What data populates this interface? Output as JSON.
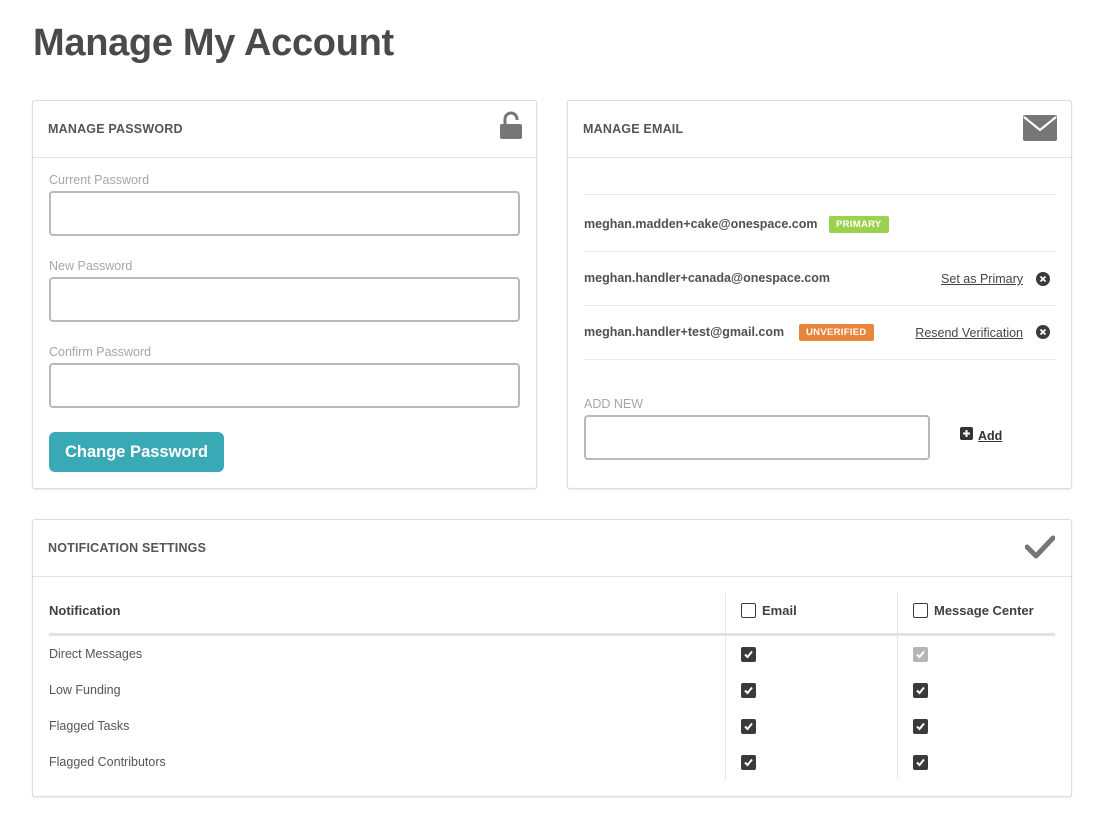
{
  "page": {
    "title": "Manage My Account"
  },
  "password_panel": {
    "title": "MANAGE PASSWORD",
    "icon": "unlock-icon",
    "fields": [
      {
        "label": "Current Password",
        "value": ""
      },
      {
        "label": "New Password",
        "value": ""
      },
      {
        "label": "Confirm Password",
        "value": ""
      }
    ],
    "submit_label": "Change Password"
  },
  "email_panel": {
    "title": "MANAGE EMAIL",
    "icon": "envelope-icon",
    "emails": [
      {
        "address": "meghan.madden+cake@onespace.com",
        "badge": "PRIMARY",
        "action": ""
      },
      {
        "address": "meghan.handler+canada@onespace.com",
        "badge": "",
        "action": "Set as Primary"
      },
      {
        "address": "meghan.handler+test@gmail.com",
        "badge": "UNVERIFIED",
        "action": "Resend Verification"
      }
    ],
    "add_new": {
      "label": "ADD NEW",
      "value": "",
      "button_label": "Add"
    }
  },
  "notification_panel": {
    "title": "NOTIFICATION SETTINGS",
    "icon": "checkmark-icon",
    "columns": {
      "notification": "Notification",
      "email": "Email",
      "message_center": "Message Center"
    },
    "header_checks": {
      "email": false,
      "message_center": false
    },
    "rows": [
      {
        "label": "Direct Messages",
        "email": true,
        "message_center": true,
        "message_center_disabled": true
      },
      {
        "label": "Low Funding",
        "email": true,
        "message_center": true,
        "message_center_disabled": false
      },
      {
        "label": "Flagged Tasks",
        "email": true,
        "message_center": true,
        "message_center_disabled": false
      },
      {
        "label": "Flagged Contributors",
        "email": true,
        "message_center": true,
        "message_center_disabled": false
      }
    ]
  },
  "colors": {
    "accent": "#3aa9b6",
    "primary_badge": "#9bd14c",
    "unverified_badge": "#e8853a",
    "icon_gray": "#777777"
  }
}
